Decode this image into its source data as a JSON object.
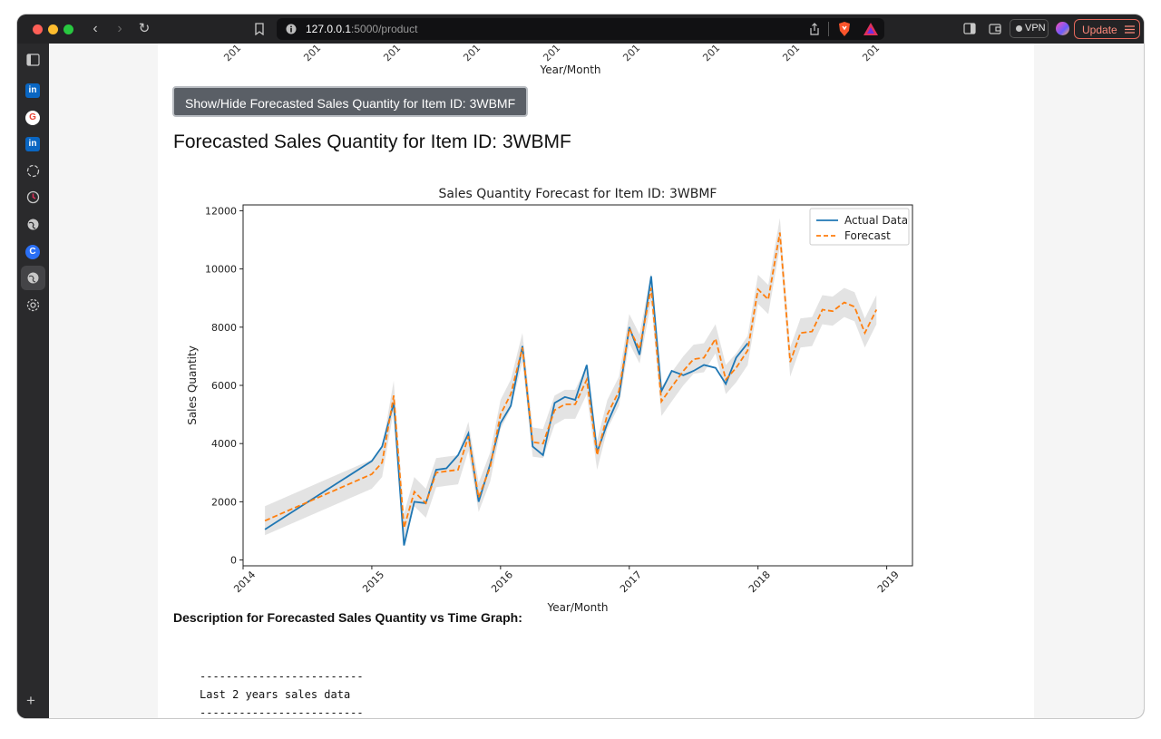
{
  "browser": {
    "url_host": "127.0.0.1",
    "url_path": ":5000/product",
    "vpn_label": "VPN",
    "update_label": "Update"
  },
  "sidebar": {
    "items": [
      {
        "icon": "sidebar-toggle-icon"
      },
      {
        "icon": "linkedin-icon"
      },
      {
        "icon": "google-icon"
      },
      {
        "icon": "linkedin-icon"
      },
      {
        "icon": "circle-dashed-icon"
      },
      {
        "icon": "timer-icon"
      },
      {
        "icon": "globe-icon"
      },
      {
        "icon": "c-app-icon"
      },
      {
        "icon": "globe-icon"
      },
      {
        "icon": "settings-icon"
      }
    ],
    "add_label": "+"
  },
  "page": {
    "top_chart_xlabel": "Year/Month",
    "top_chart_tick_stub": "201",
    "toggle_button": "Show/Hide Forecasted Sales Quantity for Item ID: 3WBMF",
    "heading": "Forecasted Sales Quantity for Item ID: 3WBMF",
    "description_title": "Description for Forecasted Sales Quantity vs Time Graph:",
    "code_lines": [
      "-------------------------",
      "Last 2 years sales data",
      "-------------------------"
    ]
  },
  "colors": {
    "actual": "#1f77b4",
    "forecast": "#ff7f0e",
    "band": "#d9d9d9"
  },
  "chart_data": {
    "type": "line",
    "title": "Sales Quantity Forecast for Item ID: 3WBMF",
    "xlabel": "Year/Month",
    "ylabel": "Sales Quantity",
    "xlim": [
      2014.0,
      2019.2
    ],
    "ylim": [
      -200,
      12200
    ],
    "xticks": [
      2014,
      2015,
      2016,
      2017,
      2018,
      2019
    ],
    "yticks": [
      0,
      2000,
      4000,
      6000,
      8000,
      10000,
      12000
    ],
    "legend": "top-right",
    "series": [
      {
        "name": "Actual Data",
        "style": "solid",
        "x": [
          2014.17,
          2015.0,
          2015.08,
          2015.17,
          2015.25,
          2015.33,
          2015.42,
          2015.5,
          2015.58,
          2015.67,
          2015.75,
          2015.83,
          2015.92,
          2016.0,
          2016.08,
          2016.17,
          2016.25,
          2016.33,
          2016.42,
          2016.5,
          2016.58,
          2016.67,
          2016.75,
          2016.83,
          2016.92,
          2017.0,
          2017.08,
          2017.17,
          2017.25,
          2017.33,
          2017.42,
          2017.5,
          2017.58,
          2017.67,
          2017.75,
          2017.83,
          2017.92
        ],
        "y": [
          1050,
          3400,
          3900,
          5400,
          500,
          2000,
          1950,
          3100,
          3150,
          3600,
          4350,
          2000,
          3300,
          4700,
          5300,
          7350,
          3900,
          3600,
          5400,
          5600,
          5500,
          6700,
          3700,
          4700,
          5600,
          8000,
          7050,
          9750,
          5800,
          6500,
          6350,
          6500,
          6700,
          6600,
          6050,
          6950,
          7450
        ]
      },
      {
        "name": "Forecast",
        "style": "dashed",
        "x": [
          2014.17,
          2015.0,
          2015.08,
          2015.17,
          2015.25,
          2015.33,
          2015.42,
          2015.5,
          2015.58,
          2015.67,
          2015.75,
          2015.83,
          2015.92,
          2016.0,
          2016.08,
          2016.17,
          2016.25,
          2016.33,
          2016.42,
          2016.5,
          2016.58,
          2016.67,
          2016.75,
          2016.83,
          2016.92,
          2017.0,
          2017.08,
          2017.17,
          2017.25,
          2017.33,
          2017.42,
          2017.5,
          2017.58,
          2017.67,
          2017.75,
          2017.83,
          2017.92,
          2018.0,
          2018.08,
          2018.17,
          2018.25,
          2018.33,
          2018.42,
          2018.5,
          2018.58,
          2018.67,
          2018.75,
          2018.83,
          2018.92
        ],
        "y": [
          1350,
          2950,
          3350,
          5650,
          1100,
          2350,
          1950,
          3000,
          3050,
          3100,
          4250,
          2150,
          3200,
          5000,
          5700,
          7300,
          4050,
          4000,
          5150,
          5350,
          5350,
          6200,
          3600,
          5000,
          5800,
          7950,
          7250,
          9350,
          5450,
          5950,
          6500,
          6900,
          6950,
          7600,
          6200,
          6600,
          7200,
          9300,
          8950,
          11250,
          6800,
          7800,
          7850,
          8600,
          8550,
          8850,
          8700,
          7800,
          8600
        ]
      }
    ],
    "band_half_width": 500
  }
}
